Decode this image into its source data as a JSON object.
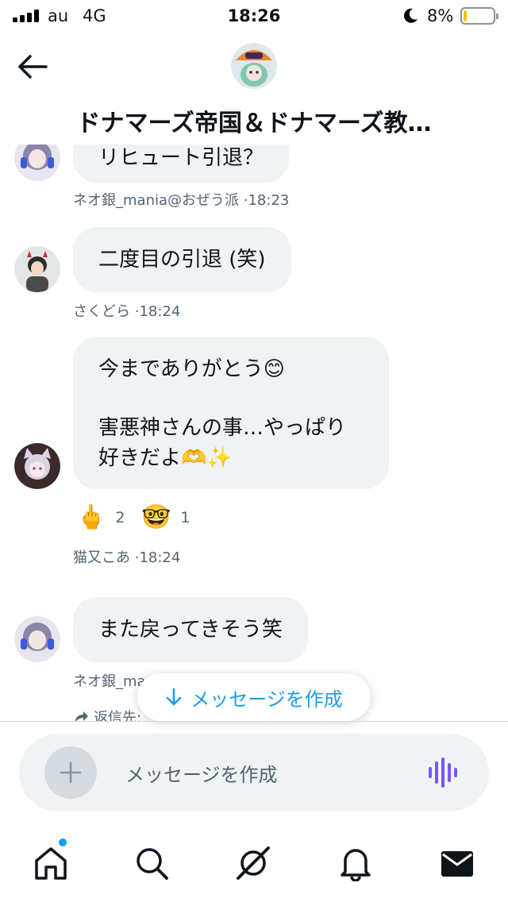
{
  "status_bar": {
    "carrier": "au",
    "network": "4G",
    "time": "18:26",
    "battery_percent": "8%",
    "battery_level": 0.08
  },
  "header": {
    "title": "ドナマーズ帝国＆ドナマーズ教…",
    "back_icon": "arrow-left-icon"
  },
  "messages": [
    {
      "text": "リヒュート引退？",
      "sender": "ネオ銀_mania@おぜう派",
      "time": "·18:23"
    },
    {
      "text": "二度目の引退 (笑)",
      "sender": "さくどら",
      "time": "·18:24"
    },
    {
      "text_line1": "今までありがとう😊",
      "text_line2": "害悪神さんの事…やっぱり",
      "text_line3": "好きだよ🫶✨",
      "sender": "猫又こあ",
      "time": "·18:24",
      "reactions": [
        {
          "emoji": "🖕",
          "count": "2"
        },
        {
          "emoji": "🤓",
          "count": "1"
        }
      ]
    },
    {
      "text": "また戻ってきそう笑",
      "sender": "ネオ銀_ma",
      "time": "",
      "reply_label": "返信先:"
    }
  ],
  "jump_button": {
    "label": "メッセージを作成",
    "icon": "arrow-down-icon"
  },
  "composer": {
    "placeholder": "メッセージを作成"
  },
  "accent_color": "#1d9bf0",
  "tabs": [
    "home-icon",
    "search-icon",
    "grok-icon",
    "notifications-icon",
    "messages-icon"
  ]
}
